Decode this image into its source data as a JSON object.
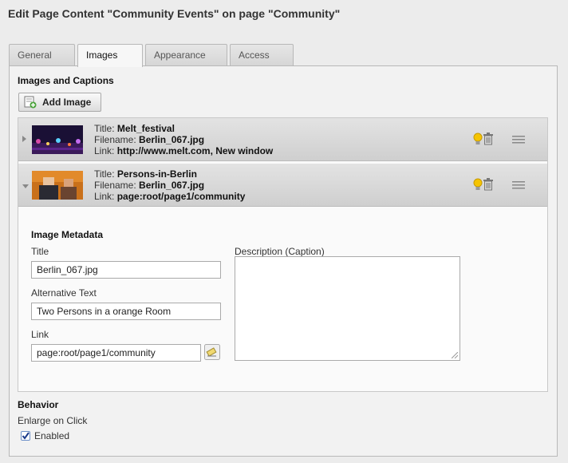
{
  "page_title": "Edit Page Content \"Community Events\" on page \"Community\"",
  "tabs": [
    {
      "label": "General"
    },
    {
      "label": "Images"
    },
    {
      "label": "Appearance"
    },
    {
      "label": "Access"
    }
  ],
  "active_tab": "Images",
  "images_section": {
    "title": "Images and Captions",
    "add_button": "Add Image",
    "items": [
      {
        "title_label": "Title:",
        "title": "Melt_festival",
        "filename_label": "Filename:",
        "filename": "Berlin_067.jpg",
        "link_label": "Link:",
        "link": "http://www.melt.com, New window",
        "expanded": false
      },
      {
        "title_label": "Title:",
        "title": "Persons-in-Berlin",
        "filename_label": "Filename:",
        "filename": "Berlin_067.jpg",
        "link_label": "Link:",
        "link": "page:root/page1/community",
        "expanded": true
      }
    ]
  },
  "metadata": {
    "title": "Image Metadata",
    "title_label": "Title",
    "title_value": "Berlin_067.jpg",
    "alt_label": "Alternative Text",
    "alt_value": "Two Persons in a orange Room",
    "link_label": "Link",
    "link_value": "page:root/page1/community",
    "description_label": "Description (Caption)",
    "description_value": ""
  },
  "behavior": {
    "title": "Behavior",
    "enlarge_label": "Enlarge on Click",
    "enabled_label": "Enabled",
    "enabled": true
  },
  "icons": [
    "add-image-icon",
    "lightbulb-icon",
    "trash-icon",
    "drag-handle-icon",
    "link-wizard-icon",
    "resize-grip-icon"
  ],
  "colors": {
    "background": "#ececec",
    "panel": "#f2f2f2",
    "checkbox": "#3b6fc6",
    "bulb": "#f5c400"
  }
}
